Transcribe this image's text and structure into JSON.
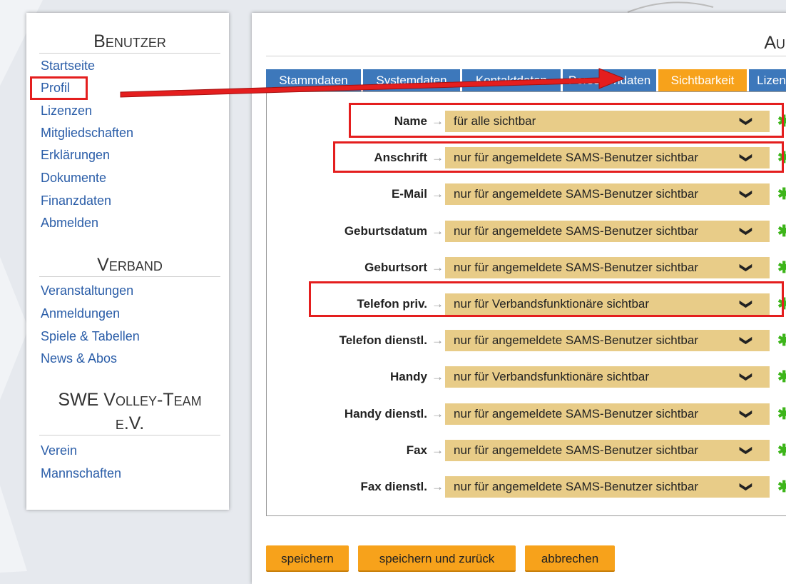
{
  "sidebar": {
    "sections": [
      {
        "heading": "Benutzer",
        "links": [
          "Startseite",
          "Profil",
          "Lizenzen",
          "Mitgliedschaften",
          "Erklärungen",
          "Dokumente",
          "Finanzdaten",
          "Abmelden"
        ]
      },
      {
        "heading": "Verband",
        "links": [
          "Veranstaltungen",
          "Anmeldungen",
          "Spiele & Tabellen",
          "News & Abos"
        ]
      },
      {
        "heading_line1": "SWE Volley-Team",
        "heading_line2": "e.V.",
        "links": [
          "Verein",
          "Mannschaften"
        ]
      }
    ]
  },
  "main": {
    "title": "Aue",
    "tabs": [
      "Stammdaten",
      "Systemdaten",
      "Kontaktdaten",
      "Personendaten",
      "Sichtbarkeit",
      "Lizen"
    ],
    "active_tab": "Sichtbarkeit",
    "rows": [
      {
        "label": "Name",
        "value": "für alle sichtbar"
      },
      {
        "label": "Anschrift",
        "value": "nur für angemeldete SAMS-Benutzer sichtbar"
      },
      {
        "label": "E-Mail",
        "value": "nur für angemeldete SAMS-Benutzer sichtbar"
      },
      {
        "label": "Geburtsdatum",
        "value": "nur für angemeldete SAMS-Benutzer sichtbar"
      },
      {
        "label": "Geburtsort",
        "value": "nur für angemeldete SAMS-Benutzer sichtbar"
      },
      {
        "label": "Telefon priv.",
        "value": "nur für Verbandsfunktionäre sichtbar"
      },
      {
        "label": "Telefon dienstl.",
        "value": "nur für angemeldete SAMS-Benutzer sichtbar"
      },
      {
        "label": "Handy",
        "value": "nur für Verbandsfunktionäre sichtbar"
      },
      {
        "label": "Handy dienstl.",
        "value": "nur für angemeldete SAMS-Benutzer sichtbar"
      },
      {
        "label": "Fax",
        "value": "nur für angemeldete SAMS-Benutzer sichtbar"
      },
      {
        "label": "Fax dienstl.",
        "value": "nur für angemeldete SAMS-Benutzer sichtbar"
      }
    ],
    "arrow_glyph": "→",
    "star_glyph": "✱",
    "chevron_glyph": "❯",
    "buttons": {
      "save": "speichern",
      "save_back": "speichern und zurück",
      "cancel": "abbrechen"
    }
  },
  "colors": {
    "accent": "#f7a21b",
    "tab": "#3d78bb",
    "select": "#e8cc88",
    "highlight": "#e41e1e",
    "star": "#3db51a",
    "link": "#2a5da8"
  }
}
